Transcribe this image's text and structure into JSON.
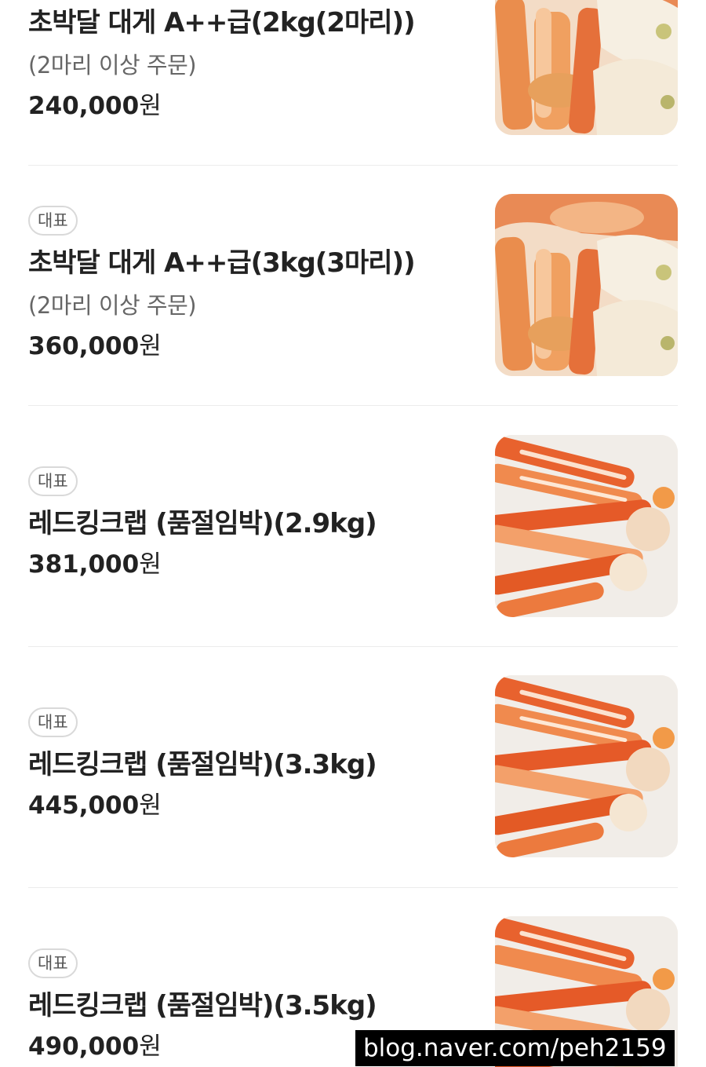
{
  "menu": {
    "items": [
      {
        "badge": "",
        "name": "초박달 대게 A++급(2kg(2마리))",
        "desc": "(2마리 이상 주문)",
        "price": "240,000",
        "currency": "원",
        "image": "snow-crab-legs-photo"
      },
      {
        "badge": "대표",
        "name": "초박달 대게 A++급(3kg(3마리))",
        "desc": "(2마리 이상 주문)",
        "price": "360,000",
        "currency": "원",
        "image": "snow-crab-legs-photo"
      },
      {
        "badge": "대표",
        "name": "레드킹크랩 (품절임박)(2.9kg)",
        "desc": "",
        "price": "381,000",
        "currency": "원",
        "image": "king-crab-legs-photo"
      },
      {
        "badge": "대표",
        "name": "레드킹크랩 (품절임박)(3.3kg)",
        "desc": "",
        "price": "445,000",
        "currency": "원",
        "image": "king-crab-legs-photo"
      },
      {
        "badge": "대표",
        "name": "레드킹크랩 (품절임박)(3.5kg)",
        "desc": "",
        "price": "490,000",
        "currency": "원",
        "image": "king-crab-legs-photo"
      }
    ]
  },
  "watermark": "blog.naver.com/peh2159"
}
